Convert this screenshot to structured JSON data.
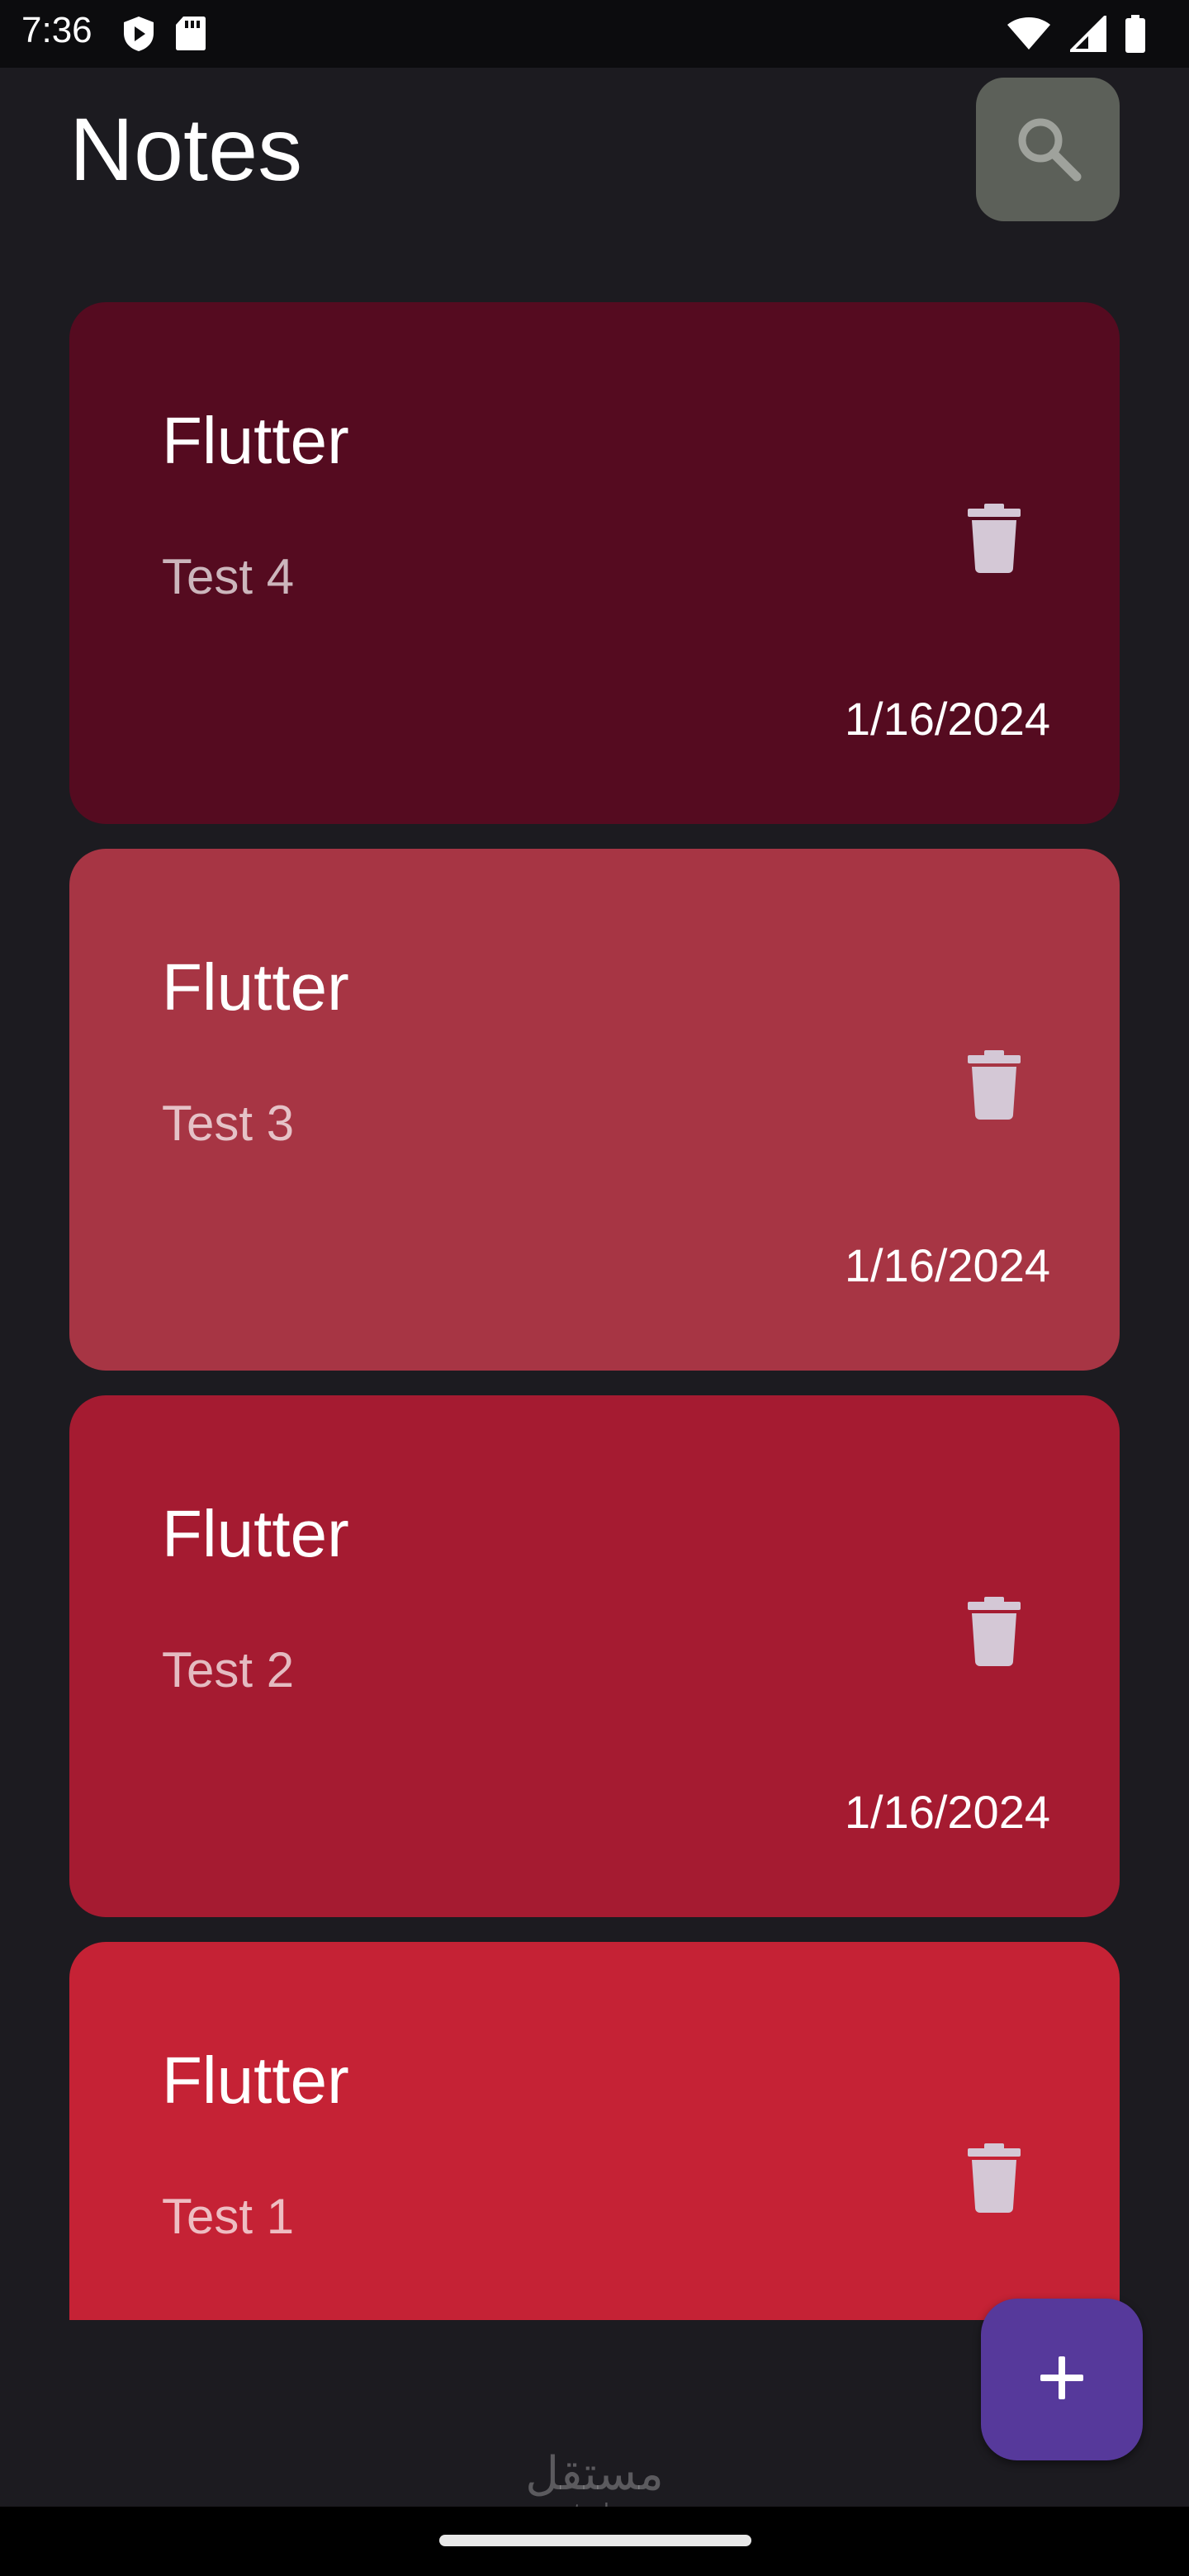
{
  "status_bar": {
    "time": "7:36",
    "left_icons": [
      "shield-play-icon",
      "sd-card-icon"
    ],
    "right_icons": [
      "wifi-icon",
      "cell-signal-icon",
      "battery-icon"
    ]
  },
  "header": {
    "title": "Notes",
    "search_icon": "search-icon"
  },
  "notes": [
    {
      "title": "Flutter",
      "body": "Test 4",
      "date": "1/16/2024",
      "color": "#550b20"
    },
    {
      "title": "Flutter",
      "body": "Test 3",
      "date": "1/16/2024",
      "color": "#a73544"
    },
    {
      "title": "Flutter",
      "body": "Test 2",
      "date": "1/16/2024",
      "color": "#a51b31"
    },
    {
      "title": "Flutter",
      "body": "Test 1",
      "date": "",
      "color": "#c52235"
    }
  ],
  "fab": {
    "icon": "plus-icon",
    "color": "#56399b"
  },
  "watermark": {
    "arabic": "مستقل",
    "latin": "mostaql.com"
  },
  "colors": {
    "background": "#1c1b20",
    "search_button": "#5c6059",
    "icon_tint": "#d4c8d6"
  }
}
